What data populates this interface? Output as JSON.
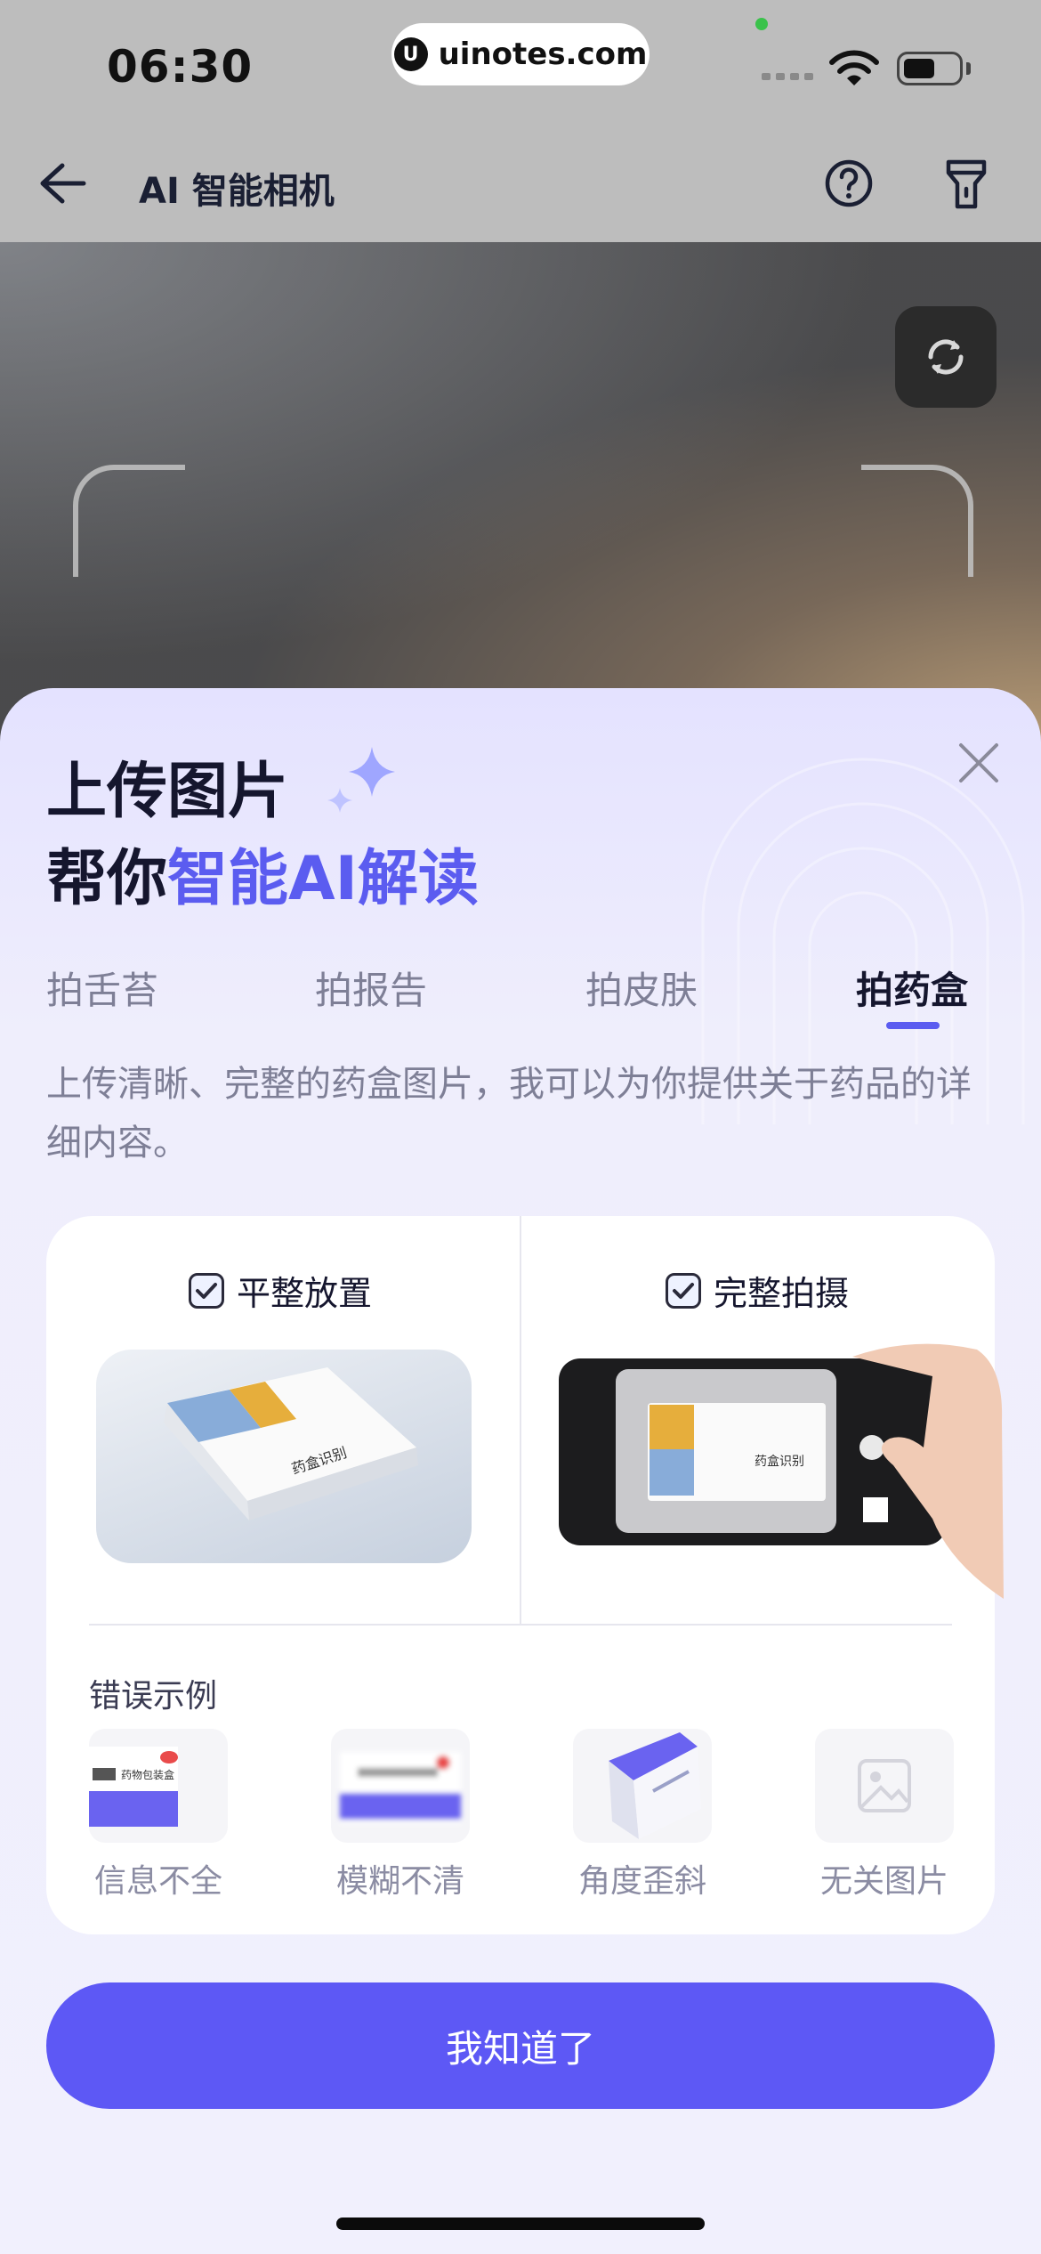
{
  "status_bar": {
    "time": "06:30",
    "url_logo": "U",
    "url": "uinotes.com"
  },
  "header": {
    "title": "AI 智能相机"
  },
  "sheet": {
    "headline_line1": "上传图片",
    "headline_line2_plain": "帮你",
    "headline_line2_accent": "智能AI解读",
    "tabs": [
      {
        "label": "拍舌苔",
        "active": false
      },
      {
        "label": "拍报告",
        "active": false
      },
      {
        "label": "拍皮肤",
        "active": false
      },
      {
        "label": "拍药盒",
        "active": true
      }
    ],
    "description": "上传清晰、完整的药盒图片，我可以为你提供关于药品的详细内容。",
    "tips": [
      {
        "label": "平整放置"
      },
      {
        "label": "完整拍摄"
      }
    ],
    "box_text": "药盒识别",
    "errors_title": "错误示例",
    "errors": [
      {
        "label": "信息不全",
        "thumb_text": "药物包装盒"
      },
      {
        "label": "模糊不清"
      },
      {
        "label": "角度歪斜"
      },
      {
        "label": "无关图片"
      }
    ],
    "confirm_button": "我知道了"
  },
  "colors": {
    "accent": "#5b5cf0",
    "button": "#5d58f5",
    "header_bg": "#bdbdbd"
  }
}
